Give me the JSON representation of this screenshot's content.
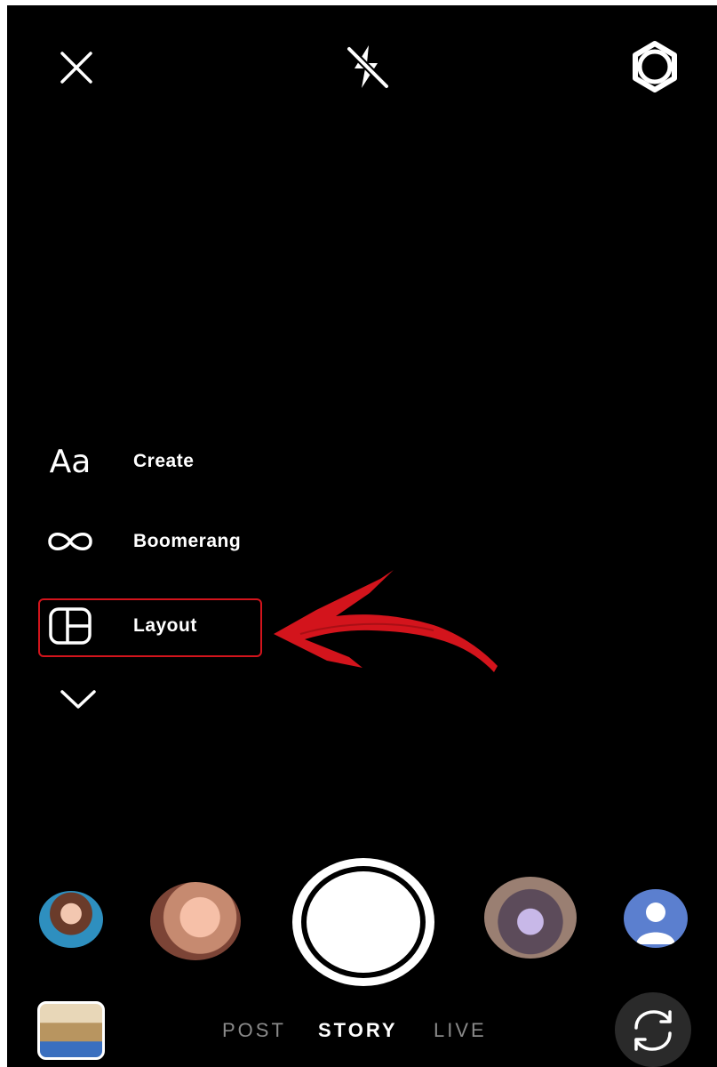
{
  "top_bar": {
    "close_icon": "close-icon",
    "flash_icon": "flash-off-icon",
    "settings_icon": "settings-gear-icon"
  },
  "tools_menu": {
    "items": [
      {
        "icon": "text-aa-icon",
        "icon_text": "Aa",
        "label": "Create"
      },
      {
        "icon": "infinity-icon",
        "label": "Boomerang"
      },
      {
        "icon": "layout-grid-icon",
        "label": "Layout"
      }
    ],
    "expand_icon": "chevron-down-icon",
    "highlighted_item": "Layout"
  },
  "annotation": {
    "arrow_color": "#d3141c",
    "box_color": "#d3141c"
  },
  "effects_tray": {
    "avatars": [
      "avatar-1",
      "avatar-2",
      "avatar-4",
      "avatar-5"
    ]
  },
  "capture": {
    "shutter": "capture-button"
  },
  "modes": {
    "items": [
      "POST",
      "STORY",
      "LIVE"
    ],
    "active": "STORY"
  },
  "bottom_bar": {
    "gallery_icon": "gallery-thumbnail",
    "flip_icon": "camera-flip-icon"
  }
}
